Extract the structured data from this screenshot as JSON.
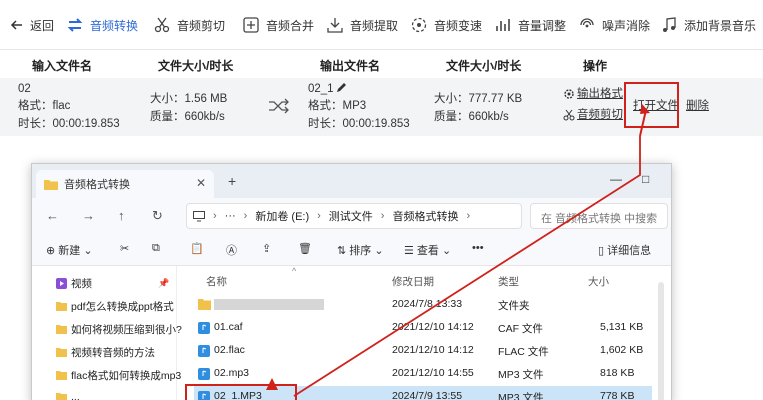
{
  "toolbar": {
    "back": "返回",
    "items": [
      {
        "label": "音频转换",
        "icon": "convert-icon"
      },
      {
        "label": "音频剪切",
        "icon": "scissors-icon"
      },
      {
        "label": "音频合并",
        "icon": "merge-icon"
      },
      {
        "label": "音频提取",
        "icon": "extract-icon"
      },
      {
        "label": "音频变速",
        "icon": "speed-icon"
      },
      {
        "label": "音量调整",
        "icon": "volume-bars-icon"
      },
      {
        "label": "噪声消除",
        "icon": "noise-icon"
      },
      {
        "label": "添加背景音乐",
        "icon": "music-note-icon"
      }
    ],
    "active_color": "#2f6bd8"
  },
  "table": {
    "headers": {
      "input": "输入文件名",
      "size_duration": "文件大小/时长",
      "output": "输出文件名",
      "out_size_duration": "文件大小/时长",
      "actions": "操作"
    },
    "row": {
      "input_name": "02",
      "input_format": "格式：flac",
      "input_duration": "时长：00:00:19.853",
      "input_size": "大小：1.56 MB",
      "input_quality": "质量：660kb/s",
      "output_name": "02_1",
      "output_format": "格式：MP3",
      "output_duration": "时长：00:00:19.853",
      "output_size": "大小：777.77 KB",
      "output_quality": "质量：660kb/s",
      "output_format_btn": "输出格式",
      "audio_cut_btn": "音频剪切",
      "open_file_btn": "打开文件",
      "delete_btn": "删除"
    }
  },
  "explorer": {
    "tab_title": "音频格式转换",
    "new_tab": "+",
    "window_controls": [
      "—",
      "□",
      "✕"
    ],
    "path": [
      "新加卷 (E:)",
      "测试文件",
      "音频格式转换"
    ],
    "search_placeholder": "在 音频格式转换 中搜索",
    "commands": {
      "new": "新建",
      "sort": "排序",
      "view": "查看",
      "more": "•••",
      "details": "详细信息"
    },
    "sidebar": [
      {
        "label": "视频",
        "icon": "video-folder-icon"
      },
      {
        "label": "pdf怎么转换成ppt格式",
        "icon": "folder-icon"
      },
      {
        "label": "如何将视频压缩到很小?",
        "icon": "folder-icon"
      },
      {
        "label": "视频转音频的方法",
        "icon": "folder-icon"
      },
      {
        "label": "flac格式如何转换成mp3",
        "icon": "folder-icon"
      },
      {
        "label": "...",
        "icon": "folder-icon"
      }
    ],
    "columns": {
      "name": "名称",
      "date": "修改日期",
      "type": "类型",
      "size": "大小"
    },
    "files": [
      {
        "name": "",
        "date": "2024/7/8 13:33",
        "type": "文件夹",
        "size": "",
        "icon": "folder-icon"
      },
      {
        "name": "01.caf",
        "date": "2021/12/10 14:12",
        "type": "CAF 文件",
        "size": "5,131 KB",
        "icon": "audio-file-icon"
      },
      {
        "name": "02.flac",
        "date": "2021/12/10 14:12",
        "type": "FLAC 文件",
        "size": "1,602 KB",
        "icon": "audio-file-icon"
      },
      {
        "name": "02.mp3",
        "date": "2021/12/10 14:55",
        "type": "MP3 文件",
        "size": "818 KB",
        "icon": "audio-file-icon"
      },
      {
        "name": "02_1.MP3",
        "date": "2024/7/9 13:55",
        "type": "MP3 文件",
        "size": "778 KB",
        "icon": "audio-file-icon"
      }
    ]
  },
  "annotation_color": "#d0211a"
}
